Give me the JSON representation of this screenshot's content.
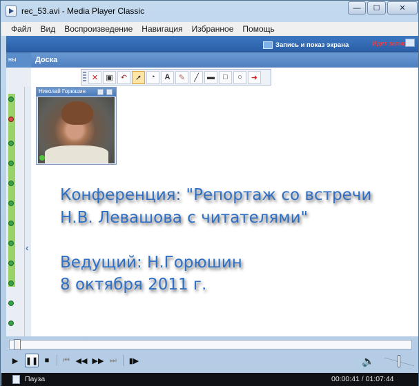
{
  "window": {
    "title": "rec_53.avi - Media Player Classic",
    "min_glyph": "—",
    "max_glyph": "☐",
    "close_glyph": "✕"
  },
  "menu": {
    "items": [
      "Файл",
      "Вид",
      "Воспроизведение",
      "Навигация",
      "Избранное",
      "Помощь"
    ]
  },
  "video": {
    "record_label": "Запись и показ экрана",
    "record_status": "Идет запись...",
    "strip_label": "ны",
    "board_title": "Доска",
    "webcam_name": "Николай Горюшин",
    "conference_lines": [
      "Конференция: \"Репортаж со встречи",
      "Н.В. Левашова с читателями\"",
      "Ведущий: Н.Горюшин",
      "8 октября 2011 г."
    ],
    "toolbar_icons": [
      "close-icon",
      "new-page-icon",
      "undo-icon",
      "pointer-icon",
      "highlight-icon",
      "text-tool-icon",
      "pencil-icon",
      "line-icon",
      "thick-line-icon",
      "rectangle-icon",
      "ellipse-icon",
      "arrow-icon"
    ]
  },
  "player": {
    "state": "paused",
    "position": "00:00:41",
    "duration": "01:07:44",
    "progress": 0.01,
    "volume": 0.5
  },
  "status": {
    "text": "Пауза",
    "time": "00:00:41 / 01:07:44"
  }
}
